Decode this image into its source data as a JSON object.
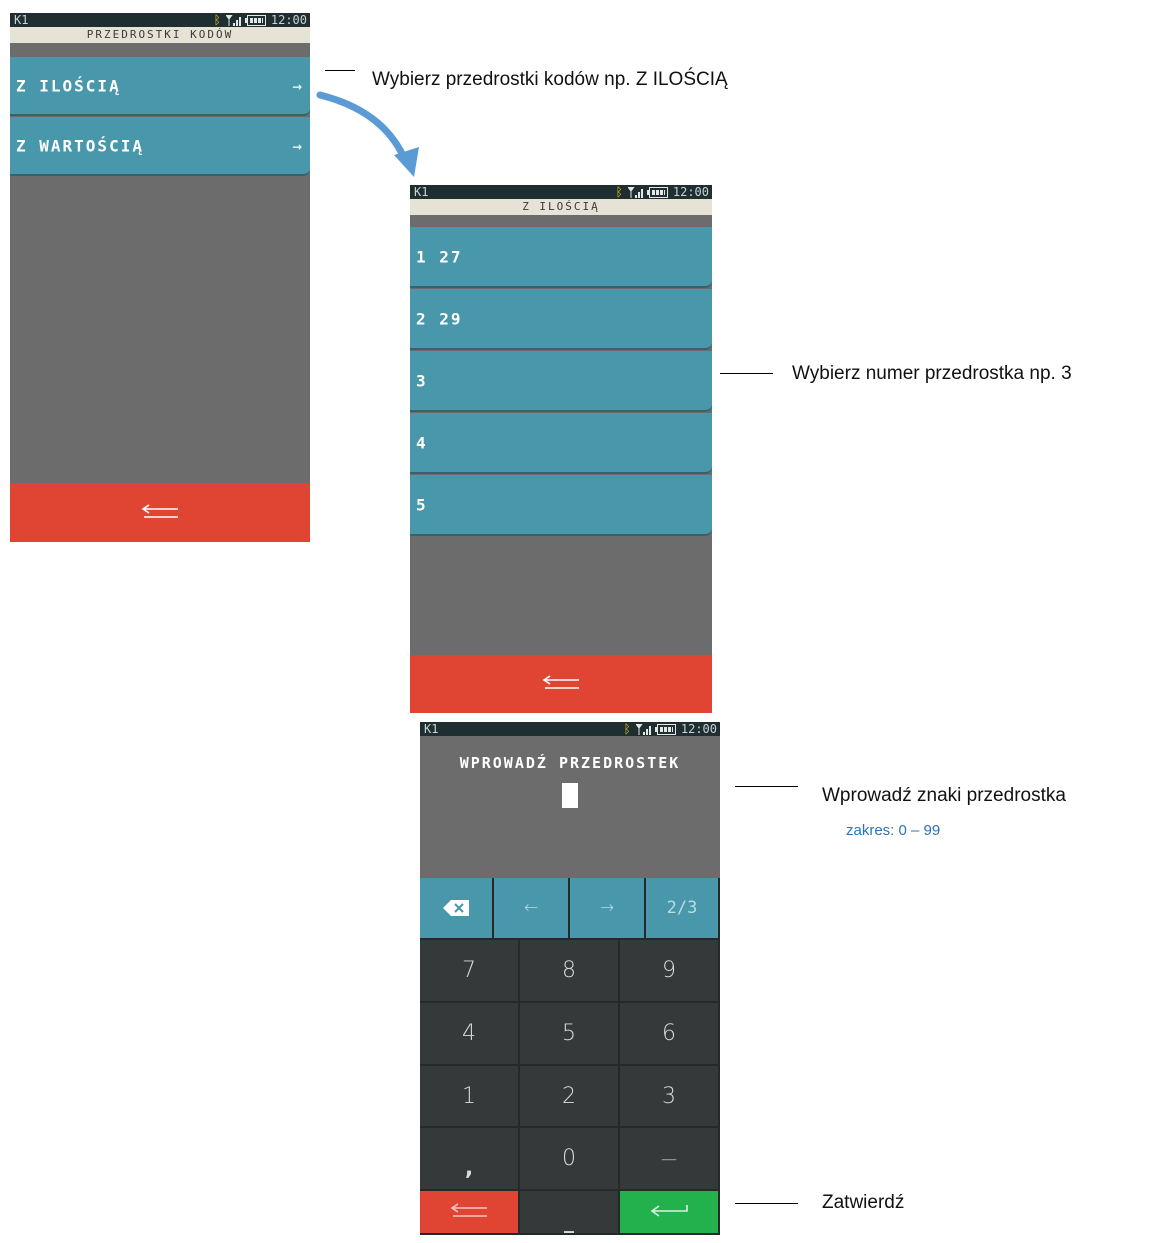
{
  "screen1": {
    "status": {
      "left": "K1",
      "time": "12:00"
    },
    "title": "PRZEDROSTKI KODÓW",
    "items": [
      {
        "label": "Z ILOŚCIĄ",
        "arrow": "→"
      },
      {
        "label": "Z WARTOŚCIĄ",
        "arrow": "→"
      }
    ]
  },
  "screen2": {
    "status": {
      "left": "K1",
      "time": "12:00"
    },
    "title": "Z ILOŚCIĄ",
    "items": [
      {
        "label": "1 27"
      },
      {
        "label": "2 29"
      },
      {
        "label": "3"
      },
      {
        "label": "4"
      },
      {
        "label": "5"
      }
    ]
  },
  "screen3": {
    "status": {
      "left": "K1",
      "time": "12:00"
    },
    "prompt": "WPROWADŹ PRZEDROSTEK",
    "func_keys": {
      "left": "←",
      "right": "→",
      "page": "2/3"
    },
    "keys": [
      "7",
      "8",
      "9",
      "4",
      "5",
      "6",
      "1",
      "2",
      "3",
      ",",
      "0",
      "—"
    ],
    "space_key": "_"
  },
  "annotations": {
    "a1": "Wybierz przedrostki kodów np. Z ILOŚCIĄ",
    "a2": "Wybierz numer przedrostka np. 3",
    "a3": "Wprowadź znaki przedrostka",
    "a3_sub": "zakres: 0 – 99",
    "a4": "Zatwierdź"
  },
  "colors": {
    "accent_teal": "#4897aa",
    "back_red": "#e04534",
    "confirm_green": "#22b14c",
    "annotation_blue": "#2e74b5",
    "arrow_blue": "#5b9bd5"
  }
}
